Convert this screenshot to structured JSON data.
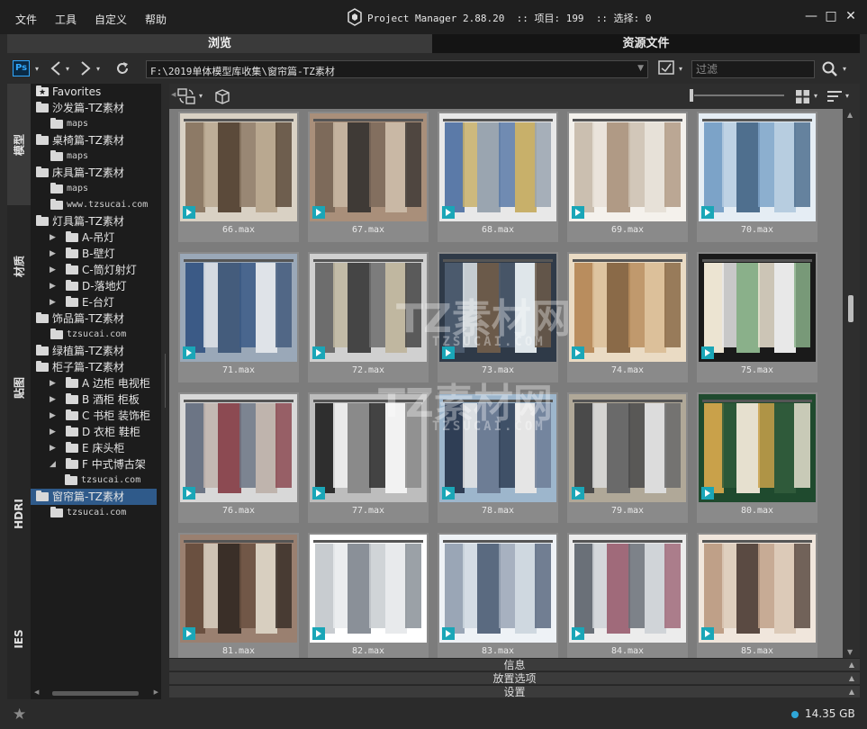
{
  "menu": [
    "文件",
    "工具",
    "自定义",
    "帮助"
  ],
  "title": {
    "app": "Project Manager 2.88.20",
    "items_label": ":: 项目: 199",
    "selection_label": ":: 选择: 0"
  },
  "window_buttons": {
    "minimize": "—",
    "maximize": "□",
    "close": "✕"
  },
  "tabs": {
    "browse": "浏览",
    "assets": "资源文件"
  },
  "toolbar": {
    "ps_label": "Ps",
    "path": "F:\\2019单体模型库收集\\窗帘篇-TZ素材",
    "filter_placeholder": "过滤"
  },
  "vertical_tabs": [
    "模型",
    "材质",
    "贴图",
    "HDRI",
    "IES"
  ],
  "tree": [
    {
      "label": "Favorites",
      "level": 0,
      "icon": "star-folder",
      "expander": ""
    },
    {
      "label": "沙发篇-TZ素材",
      "level": 0,
      "icon": "folder",
      "expander": ""
    },
    {
      "label": "maps",
      "level": 1,
      "icon": "folder",
      "expander": ""
    },
    {
      "label": "桌椅篇-TZ素材",
      "level": 0,
      "icon": "folder",
      "expander": ""
    },
    {
      "label": "maps",
      "level": 1,
      "icon": "folder",
      "expander": ""
    },
    {
      "label": "床具篇-TZ素材",
      "level": 0,
      "icon": "folder",
      "expander": ""
    },
    {
      "label": "maps",
      "level": 1,
      "icon": "folder",
      "expander": ""
    },
    {
      "label": "www.tzsucai.com",
      "level": 1,
      "icon": "folder",
      "expander": ""
    },
    {
      "label": "灯具篇-TZ素材",
      "level": 0,
      "icon": "folder",
      "expander": ""
    },
    {
      "label": "A-吊灯",
      "level": 1,
      "icon": "folder",
      "expander": "▶"
    },
    {
      "label": "B-壁灯",
      "level": 1,
      "icon": "folder",
      "expander": "▶"
    },
    {
      "label": "C-筒灯射灯",
      "level": 1,
      "icon": "folder",
      "expander": "▶"
    },
    {
      "label": "D-落地灯",
      "level": 1,
      "icon": "folder",
      "expander": "▶"
    },
    {
      "label": "E-台灯",
      "level": 1,
      "icon": "folder",
      "expander": "▶"
    },
    {
      "label": "饰品篇-TZ素材",
      "level": 0,
      "icon": "folder",
      "expander": ""
    },
    {
      "label": "tzsucai.com",
      "level": 1,
      "icon": "folder",
      "expander": ""
    },
    {
      "label": "绿植篇-TZ素材",
      "level": 0,
      "icon": "folder",
      "expander": ""
    },
    {
      "label": "柜子篇-TZ素材",
      "level": 0,
      "icon": "folder",
      "expander": ""
    },
    {
      "label": "A 边柜 电视柜",
      "level": 1,
      "icon": "folder",
      "expander": "▶"
    },
    {
      "label": "B 酒柜 柜板",
      "level": 1,
      "icon": "folder",
      "expander": "▶"
    },
    {
      "label": "C 书柜 装饰柜",
      "level": 1,
      "icon": "folder",
      "expander": "▶"
    },
    {
      "label": "D 衣柜 鞋柜",
      "level": 1,
      "icon": "folder",
      "expander": "▶"
    },
    {
      "label": "E 床头柜",
      "level": 1,
      "icon": "folder",
      "expander": "▶"
    },
    {
      "label": "F 中式博古架",
      "level": 1,
      "icon": "folder",
      "expander": "◢"
    },
    {
      "label": "tzsucai.com",
      "level": 2,
      "icon": "folder",
      "expander": ""
    },
    {
      "label": "窗帘篇-TZ素材",
      "level": 0,
      "icon": "folder",
      "expander": "",
      "selected": true
    },
    {
      "label": "tzsucai.com",
      "level": 1,
      "icon": "folder",
      "expander": ""
    }
  ],
  "files": [
    "66.max",
    "67.max",
    "68.max",
    "69.max",
    "70.max",
    "71.max",
    "72.max",
    "73.max",
    "74.max",
    "75.max",
    "76.max",
    "77.max",
    "78.max",
    "79.max",
    "80.max",
    "81.max",
    "82.max",
    "83.max",
    "84.max",
    "85.max"
  ],
  "panels": {
    "info": "信息",
    "placement": "放置选项",
    "settings": "设置"
  },
  "status": {
    "disk_size": "14.35 GB"
  },
  "watermark": {
    "text": "TZ素材网",
    "url": "TZSUCAI.COM"
  },
  "colors": {
    "accent": "#2f5a8a",
    "max_badge": "#1aa6b7",
    "disk_dot": "#2fa6d8"
  }
}
